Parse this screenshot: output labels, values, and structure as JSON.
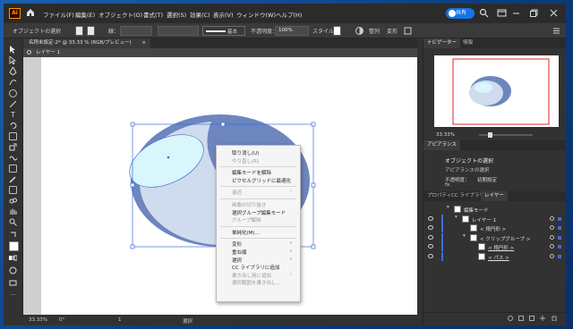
{
  "menubar": {
    "app_badge": "Ai",
    "items": [
      "ファイル(F)",
      "編集(E)",
      "オブジェクト(O)",
      "書式(T)",
      "選択(S)",
      "効果(C)",
      "表示(V)",
      "ウィンドウ(W)",
      "ヘルプ(H)"
    ],
    "share_label": "共有"
  },
  "control": {
    "object_status": "オブジェクトの選択",
    "stroke_label": "線：",
    "stroke_style": "基本",
    "opacity_label": "不透明度：",
    "opacity_value": "100%",
    "style_label": "スタイル：",
    "align_label": "整列",
    "transform_label": "変形"
  },
  "document": {
    "tab_title": "名称未設定-2* @ 33.33 % (RGB/プレビュー)",
    "tab_close": "×",
    "layer_name": "レイヤー 1"
  },
  "status": {
    "zoom": "33.33%",
    "rotation": "0°",
    "artboard_num": "1",
    "tool": "選択"
  },
  "context_menu": {
    "items": [
      {
        "label": "取り消し(U)",
        "enabled": true,
        "submenu": false
      },
      {
        "label": "やり直し(R)",
        "enabled": false,
        "submenu": false
      },
      {
        "sep": true
      },
      {
        "label": "編集モードを解除",
        "enabled": true,
        "submenu": false
      },
      {
        "label": "ピクセルグリッドに最適化",
        "enabled": true,
        "submenu": false
      },
      {
        "sep": true
      },
      {
        "label": "遠近",
        "enabled": false,
        "submenu": true
      },
      {
        "sep": true
      },
      {
        "label": "画像の切り抜き",
        "enabled": false,
        "submenu": false
      },
      {
        "label": "選択グループ編集モード",
        "enabled": true,
        "submenu": false
      },
      {
        "label": "グループ解除",
        "enabled": false,
        "submenu": false
      },
      {
        "sep": true
      },
      {
        "label": "単純化(M)...",
        "enabled": true,
        "submenu": false
      },
      {
        "sep": true
      },
      {
        "label": "変形",
        "enabled": true,
        "submenu": true
      },
      {
        "label": "重ね順",
        "enabled": true,
        "submenu": true
      },
      {
        "label": "選択",
        "enabled": true,
        "submenu": true
      },
      {
        "label": "CC ライブラリに追加",
        "enabled": true,
        "submenu": false
      },
      {
        "label": "書き出し用に追加",
        "enabled": false,
        "submenu": true
      },
      {
        "label": "選択範囲を書き出し...",
        "enabled": false,
        "submenu": false
      }
    ]
  },
  "navigator": {
    "tabs": [
      "ナビゲーター",
      "情報"
    ],
    "zoom": "33.33%"
  },
  "appearance": {
    "tab": "アピアランス",
    "title": "オブジェクトの選択",
    "subtitle": "アピアランスの選択",
    "opacity_label": "不透明度：",
    "opacity_value": "初期設定",
    "fx": "fx."
  },
  "layers": {
    "tabs": [
      "プロパティ",
      "CC ライブラリ",
      "レイヤー"
    ],
    "rows": [
      {
        "label": "編集モード",
        "indent": 0
      },
      {
        "label": "レイヤー 1",
        "indent": 1
      },
      {
        "label": "< 楕円形 >",
        "indent": 2
      },
      {
        "label": "< クリップグループ >",
        "indent": 2
      },
      {
        "label": "< 楕円形 >",
        "indent": 3
      },
      {
        "label": "< パス >",
        "indent": 3
      }
    ]
  },
  "colors": {
    "accent": "#1473e6",
    "ellipse_fill": "#cfdcee",
    "ellipse_dark": "#6d86be",
    "ellipse_light": "#d8f6fb",
    "selection": "#3e6bd8"
  }
}
